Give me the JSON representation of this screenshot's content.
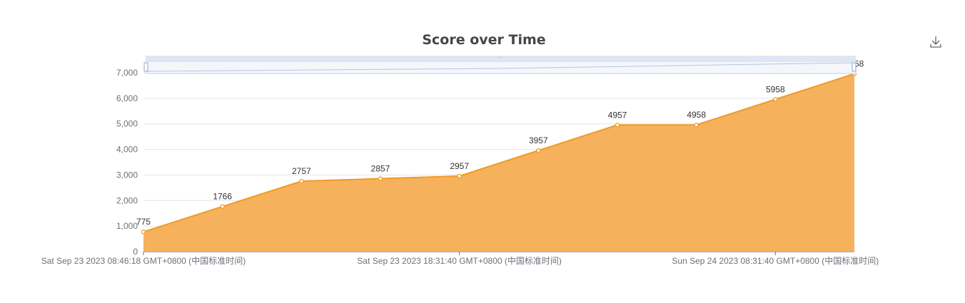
{
  "chart_data": {
    "type": "area",
    "title": "Score over Time",
    "xlabel": "",
    "ylabel": "",
    "ylim": [
      0,
      7000
    ],
    "y_ticks": [
      0,
      1000,
      2000,
      3000,
      4000,
      5000,
      6000,
      7000
    ],
    "y_tick_labels": [
      "0",
      "1,000",
      "2,000",
      "3,000",
      "4,000",
      "5,000",
      "6,000",
      "7,000"
    ],
    "x_tick_labels": [
      "Sat Sep 23 2023 08:46:18 GMT+0800 (中国标准时间)",
      "Sat Sep 23 2023 18:31:40 GMT+0800 (中国标准时间)",
      "Sun Sep 24 2023 08:31:40 GMT+0800 (中国标准时间)"
    ],
    "values": [
      775,
      1766,
      2757,
      2857,
      2957,
      3957,
      4957,
      4958,
      5958,
      6958
    ],
    "value_labels": [
      "775",
      "1766",
      "2757",
      "2857",
      "2957",
      "3957",
      "4957",
      "4958",
      "5958",
      "6958"
    ],
    "grid": true,
    "data_zoom": true,
    "colors": {
      "area": "#f5a94a",
      "line": "#ef9b26",
      "grid": "#e0e6f1",
      "axis": "#6e7079",
      "zoom_fill": "#dde4f3"
    }
  },
  "toolbox": {
    "download_icon": "download-icon"
  }
}
